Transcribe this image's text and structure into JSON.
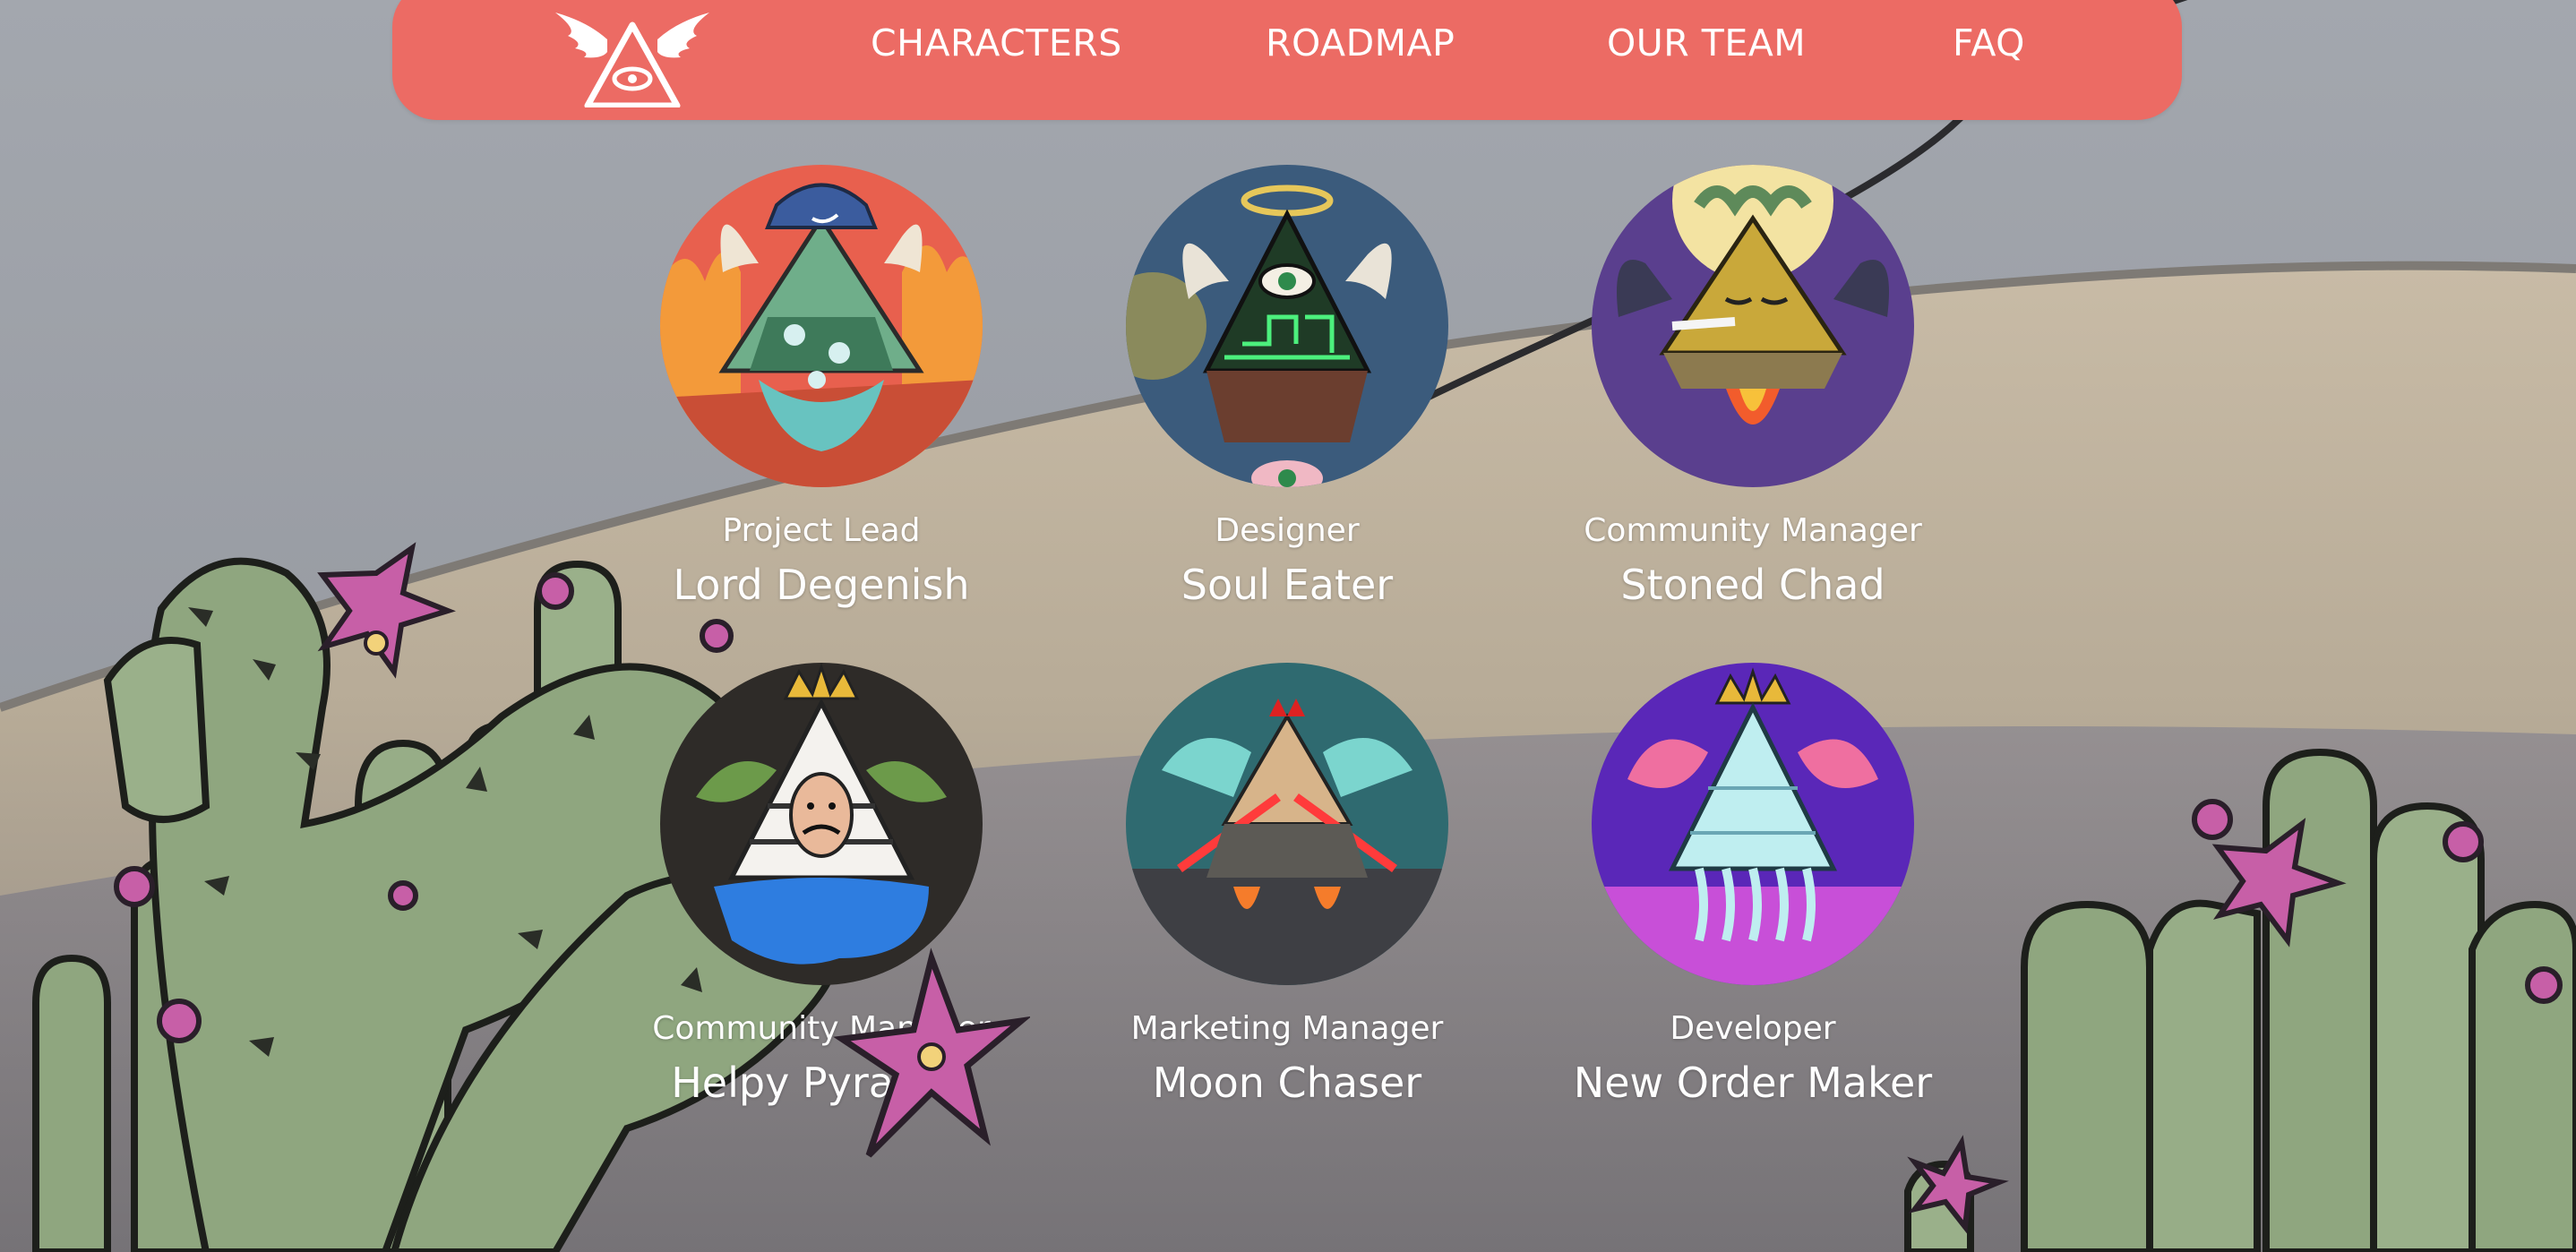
{
  "nav": {
    "logo_icon": "winged-pyramid-eye-logo",
    "links": [
      {
        "label": "CHARACTERS"
      },
      {
        "label": "ROADMAP"
      },
      {
        "label": "OUR TEAM"
      },
      {
        "label": "FAQ"
      }
    ]
  },
  "team": [
    {
      "role": "Project Lead",
      "name": "Lord Degenish",
      "avatar_bg": "#e8604e"
    },
    {
      "role": "Designer",
      "name": "Soul Eater",
      "avatar_bg": "#3b5b7c"
    },
    {
      "role": "Community Manager",
      "name": "Stoned Chad",
      "avatar_bg": "#5a3f8e"
    },
    {
      "role": "Community Manager",
      "name": "Helpy Pyramid",
      "avatar_bg": "#2e2b28"
    },
    {
      "role": "Marketing Manager",
      "name": "Moon Chaser",
      "avatar_bg": "#2f6a70"
    },
    {
      "role": "Developer",
      "name": "New Order Maker",
      "avatar_bg": "#5a27b8"
    }
  ],
  "colors": {
    "nav_bg": "#ec6b64",
    "text": "#ffffff",
    "cactus": "#8fa67f",
    "flower": "#c75fa7"
  }
}
